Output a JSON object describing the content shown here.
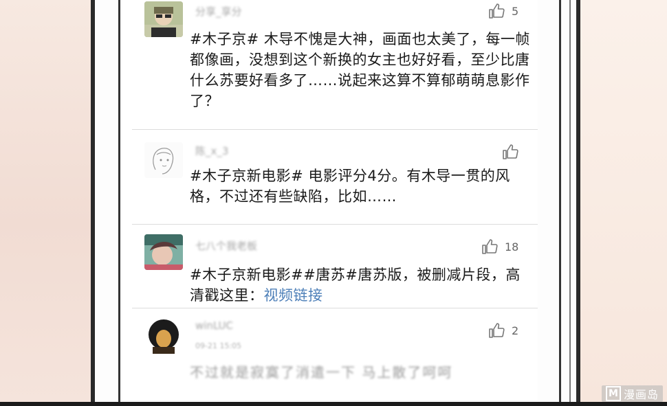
{
  "comments": [
    {
      "username": "分享_享分",
      "likes": "5",
      "text": "#木子京# 木导不愧是大神，画面也太美了，每一帧都像画，没想到这个新换的女主也好好看，至少比唐什么苏要好看多了……说起来这算不算郁萌萌息影作了？"
    },
    {
      "username": "陈_x_3",
      "likes": "",
      "text": "#木子京新电影# 电影评分4分。有木导一贯的风格，不过还有些缺陷，比如……"
    },
    {
      "username": "七八个我老板",
      "likes": "18",
      "text": "#木子京新电影##唐苏#唐苏版，被删减片段，高清戳这里：",
      "link": "视频链接"
    },
    {
      "username": "winLUC",
      "timestamp": "09-21 15:05",
      "likes": "2",
      "text": "不过就是寂寞了消遣一下 马上散了呵呵"
    }
  ],
  "watermark": {
    "logo": "M",
    "text": "漫画岛"
  },
  "icons": {
    "like": "thumbs-up-icon"
  }
}
